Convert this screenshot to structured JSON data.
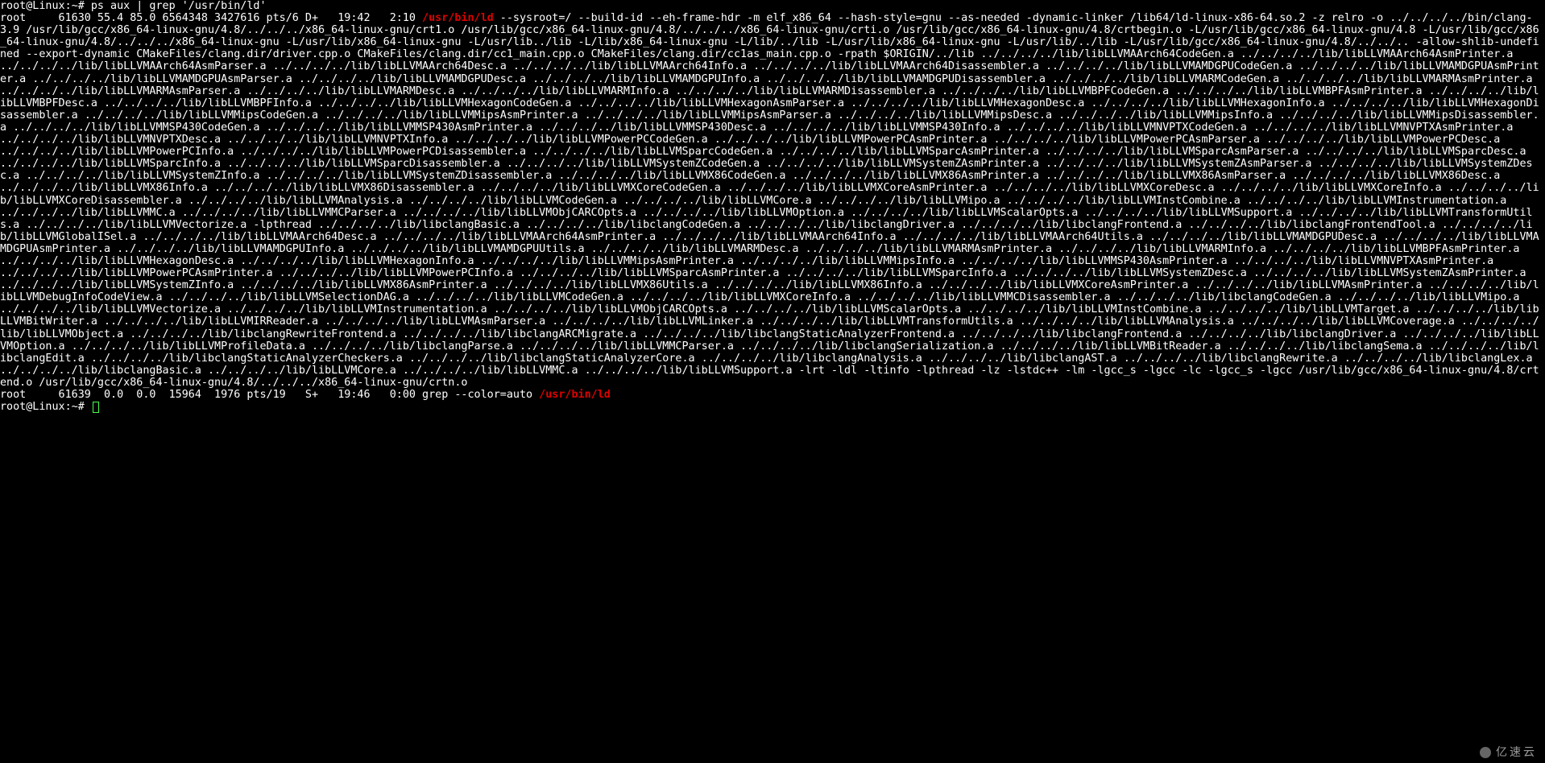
{
  "prompt1": "root@Linux:~# ",
  "command": "ps aux | grep '/usr/bin/ld'",
  "ps_line1_pre": "root     61630 55.4 85.0 6564348 3427616 pts/6 D+   19:42   2:10 ",
  "ps_line1_hl": "/usr/bin/ld",
  "ps_body": " --sysroot=/ --build-id --eh-frame-hdr -m elf_x86_64 --hash-style=gnu --as-needed -dynamic-linker /lib64/ld-linux-x86-64.so.2 -z relro -o ../../../../bin/clang-3.9 /usr/lib/gcc/x86_64-linux-gnu/4.8/../../../x86_64-linux-gnu/crt1.o /usr/lib/gcc/x86_64-linux-gnu/4.8/../../../x86_64-linux-gnu/crti.o /usr/lib/gcc/x86_64-linux-gnu/4.8/crtbegin.o -L/usr/lib/gcc/x86_64-linux-gnu/4.8 -L/usr/lib/gcc/x86_64-linux-gnu/4.8/../../../x86_64-linux-gnu -L/usr/lib/x86_64-linux-gnu -L/usr/lib../lib -L/lib/x86_64-linux-gnu -L/lib/../lib -L/usr/lib/x86_64-linux-gnu -L/usr/lib/../lib -L/usr/lib/gcc/x86_64-linux-gnu/4.8/../../.. -allow-shlib-undefined --export-dynamic CMakeFiles/clang.dir/driver.cpp.o CMakeFiles/clang.dir/cc1_main.cpp.o CMakeFiles/clang.dir/cc1as_main.cpp.o -rpath $ORIGIN/../lib ../../../../lib/libLLVMAArch64CodeGen.a ../../../../lib/libLLVMAArch64AsmPrinter.a ../../../../lib/libLLVMAArch64AsmParser.a ../../../../lib/libLLVMAArch64Desc.a ../../../../lib/libLLVMAArch64Info.a ../../../../lib/libLLVMAArch64Disassembler.a ../../../../lib/libLLVMAMDGPUCodeGen.a ../../../../lib/libLLVMAMDGPUAsmPrinter.a ../../../../lib/libLLVMAMDGPUAsmParser.a ../../../../lib/libLLVMAMDGPUDesc.a ../../../../lib/libLLVMAMDGPUInfo.a ../../../../lib/libLLVMAMDGPUDisassembler.a ../../../../lib/libLLVMARMCodeGen.a ../../../../lib/libLLVMARMAsmPrinter.a ../../../../lib/libLLVMARMAsmParser.a ../../../../lib/libLLVMARMDesc.a ../../../../lib/libLLVMARMInfo.a ../../../../lib/libLLVMARMDisassembler.a ../../../../lib/libLLVMBPFCodeGen.a ../../../../lib/libLLVMBPFAsmPrinter.a ../../../../lib/libLLVMBPFDesc.a ../../../../lib/libLLVMBPFInfo.a ../../../../lib/libLLVMHexagonCodeGen.a ../../../../lib/libLLVMHexagonAsmParser.a ../../../../lib/libLLVMHexagonDesc.a ../../../../lib/libLLVMHexagonInfo.a ../../../../lib/libLLVMHexagonDisassembler.a ../../../../lib/libLLVMMipsCodeGen.a ../../../../lib/libLLVMMipsAsmPrinter.a ../../../../lib/libLLVMMipsAsmParser.a ../../../../lib/libLLVMMipsDesc.a ../../../../lib/libLLVMMipsInfo.a ../../../../lib/libLLVMMipsDisassembler.a ../../../../lib/libLLVMMSP430CodeGen.a ../../../../lib/libLLVMMSP430AsmPrinter.a ../../../../lib/libLLVMMSP430Desc.a ../../../../lib/libLLVMMSP430Info.a ../../../../lib/libLLVMNVPTXCodeGen.a ../../../../lib/libLLVMNVPTXAsmPrinter.a ../../../../lib/libLLVMNVPTXDesc.a ../../../../lib/libLLVMNVPTXInfo.a ../../../../lib/libLLVMPowerPCCodeGen.a ../../../../lib/libLLVMPowerPCAsmPrinter.a ../../../../lib/libLLVMPowerPCAsmParser.a ../../../../lib/libLLVMPowerPCDesc.a ../../../../lib/libLLVMPowerPCInfo.a ../../../../lib/libLLVMPowerPCDisassembler.a ../../../../lib/libLLVMSparcCodeGen.a ../../../../lib/libLLVMSparcAsmPrinter.a ../../../../lib/libLLVMSparcAsmParser.a ../../../../lib/libLLVMSparcDesc.a ../../../../lib/libLLVMSparcInfo.a ../../../../lib/libLLVMSparcDisassembler.a ../../../../lib/libLLVMSystemZCodeGen.a ../../../../lib/libLLVMSystemZAsmPrinter.a ../../../../lib/libLLVMSystemZAsmParser.a ../../../../lib/libLLVMSystemZDesc.a ../../../../lib/libLLVMSystemZInfo.a ../../../../lib/libLLVMSystemZDisassembler.a ../../../../lib/libLLVMX86CodeGen.a ../../../../lib/libLLVMX86AsmPrinter.a ../../../../lib/libLLVMX86AsmParser.a ../../../../lib/libLLVMX86Desc.a ../../../../lib/libLLVMX86Info.a ../../../../lib/libLLVMX86Disassembler.a ../../../../lib/libLLVMXCoreCodeGen.a ../../../../lib/libLLVMXCoreAsmPrinter.a ../../../../lib/libLLVMXCoreDesc.a ../../../../lib/libLLVMXCoreInfo.a ../../../../lib/libLLVMXCoreDisassembler.a ../../../../lib/libLLVMAnalysis.a ../../../../lib/libLLVMCodeGen.a ../../../../lib/libLLVMCore.a ../../../../lib/libLLVMipo.a ../../../../lib/libLLVMInstCombine.a ../../../../lib/libLLVMInstrumentation.a ../../../../lib/libLLVMMC.a ../../../../lib/libLLVMMCParser.a ../../../../lib/libLLVMObjCARCOpts.a ../../../../lib/libLLVMOption.a ../../../../lib/libLLVMScalarOpts.a ../../../../lib/libLLVMSupport.a ../../../../lib/libLLVMTransformUtils.a ../../../../lib/libLLVMVectorize.a -lpthread ../../../../lib/libclangBasic.a ../../../../lib/libclangCodeGen.a ../../../../lib/libclangDriver.a ../../../../lib/libclangFrontend.a ../../../../lib/libclangFrontendTool.a ../../../../lib/libLLVMGlobalISel.a ../../../../lib/libLLVMAArch64Desc.a ../../../../lib/libLLVMAArch64AsmPrinter.a ../../../../lib/libLLVMAArch64Info.a ../../../../lib/libLLVMAArch64Utils.a ../../../../lib/libLLVMAMDGPUDesc.a ../../../../lib/libLLVMAMDGPUAsmPrinter.a ../../../../lib/libLLVMAMDGPUInfo.a ../../../../lib/libLLVMAMDGPUUtils.a ../../../../lib/libLLVMARMDesc.a ../../../../lib/libLLVMARMAsmPrinter.a ../../../../lib/libLLVMARMInfo.a ../../../../lib/libLLVMBPFAsmPrinter.a ../../../../lib/libLLVMHexagonDesc.a ../../../../lib/libLLVMHexagonInfo.a ../../../../lib/libLLVMMipsAsmPrinter.a ../../../../lib/libLLVMMipsInfo.a ../../../../lib/libLLVMMSP430AsmPrinter.a ../../../../lib/libLLVMNVPTXAsmPrinter.a ../../../../lib/libLLVMPowerPCAsmPrinter.a ../../../../lib/libLLVMPowerPCInfo.a ../../../../lib/libLLVMSparcAsmPrinter.a ../../../../lib/libLLVMSparcInfo.a ../../../../lib/libLLVMSystemZDesc.a ../../../../lib/libLLVMSystemZAsmPrinter.a ../../../../lib/libLLVMSystemZInfo.a ../../../../lib/libLLVMX86AsmPrinter.a ../../../../lib/libLLVMX86Utils.a ../../../../lib/libLLVMX86Info.a ../../../../lib/libLLVMXCoreAsmPrinter.a ../../../../lib/libLLVMAsmPrinter.a ../../../../lib/libLLVMDebugInfoCodeView.a ../../../../lib/libLLVMSelectionDAG.a ../../../../lib/libLLVMCodeGen.a ../../../../lib/libLLVMXCoreInfo.a ../../../../lib/libLLVMMCDisassembler.a ../../../../lib/libclangCodeGen.a ../../../../lib/libLLVMipo.a ../../../../lib/libLLVMVectorize.a ../../../../lib/libLLVMInstrumentation.a ../../../../lib/libLLVMObjCARCOpts.a ../../../../lib/libLLVMScalarOpts.a ../../../../lib/libLLVMInstCombine.a ../../../../lib/libLLVMTarget.a ../../../../lib/libLLVMBitWriter.a ../../../../lib/libLLVMIRReader.a ../../../../lib/libLLVMAsmParser.a ../../../../lib/libLLVMLinker.a ../../../../lib/libLLVMTransformUtils.a ../../../../lib/libLLVMAnalysis.a ../../../../lib/libLLVMCoverage.a ../../../../lib/libLLVMObject.a ../../../../lib/libclangRewriteFrontend.a ../../../../lib/libclangARCMigrate.a ../../../../lib/libclangStaticAnalyzerFrontend.a ../../../../lib/libclangFrontend.a ../../../../lib/libclangDriver.a ../../../../lib/libLLVMOption.a ../../../../lib/libLLVMProfileData.a ../../../../lib/libclangParse.a ../../../../lib/libLLVMMCParser.a ../../../../lib/libclangSerialization.a ../../../../lib/libLLVMBitReader.a ../../../../lib/libclangSema.a ../../../../lib/libclangEdit.a ../../../../lib/libclangStaticAnalyzerCheckers.a ../../../../lib/libclangStaticAnalyzerCore.a ../../../../lib/libclangAnalysis.a ../../../../lib/libclangAST.a ../../../../lib/libclangRewrite.a ../../../../lib/libclangLex.a ../../../../lib/libclangBasic.a ../../../../lib/libLLVMCore.a ../../../../lib/libLLVMMC.a ../../../../lib/libLLVMSupport.a -lrt -ldl -ltinfo -lpthread -lz -lstdc++ -lm -lgcc_s -lgcc -lc -lgcc_s -lgcc /usr/lib/gcc/x86_64-linux-gnu/4.8/crtend.o /usr/lib/gcc/x86_64-linux-gnu/4.8/../../../x86_64-linux-gnu/crtn.o",
  "ps_line2_pre": "root     61639  0.0  0.0  15964  1976 pts/19   S+   19:46   0:00 grep --color=auto ",
  "ps_line2_hl": "/usr/bin/ld",
  "prompt2": "root@Linux:~# ",
  "watermark": "亿速云"
}
